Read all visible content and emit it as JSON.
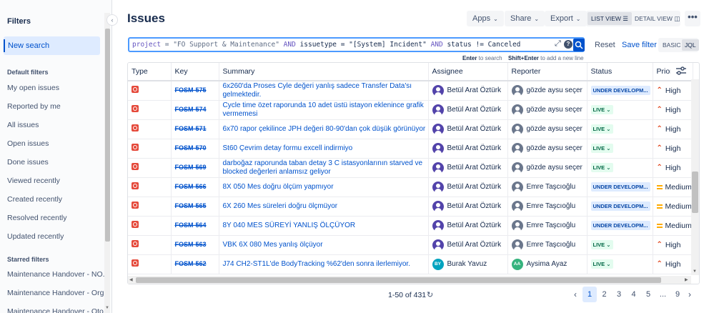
{
  "sidebar": {
    "title": "Filters",
    "new_search": "New search",
    "default_header": "Default filters",
    "default_items": [
      "My open issues",
      "Reported by me",
      "All issues",
      "Open issues",
      "Done issues",
      "Viewed recently",
      "Created recently",
      "Resolved recently",
      "Updated recently"
    ],
    "starred_header": "Starred filters",
    "starred_items": [
      "Maintenance Handover - NO...",
      "Maintenance Handover - Org...",
      "Maintenance Handover - Oto..."
    ]
  },
  "header": {
    "title": "Issues",
    "apps": "Apps",
    "share": "Share",
    "export": "Export",
    "list_view": "LIST VIEW",
    "detail_view": "DETAIL VIEW",
    "more": "•••"
  },
  "query": {
    "p1": "project",
    "p2": " = \"FO Support & Maintenance\" ",
    "and1": "AND",
    "p3": " issuetype = \"[System] Incident\" ",
    "and2": "AND",
    "p4": " status != Canceled",
    "hint_enter_key": "Enter",
    "hint_enter_text": " to search",
    "hint_shift_key": "Shift+Enter",
    "hint_shift_text": " to add a new line",
    "reset": "Reset",
    "save_filter": "Save filter",
    "basic": "BASIC",
    "jql": "JQL"
  },
  "table": {
    "columns": [
      "Type",
      "Key",
      "Summary",
      "Assignee",
      "Reporter",
      "Status",
      "Priori"
    ],
    "rows": [
      {
        "key": "FOSM-575",
        "summary": "6x260'da Proses Cyle değeri yanlış sadece Transfer Data'sı gelmektedir.",
        "assignee": "Betül Arat Öztürk",
        "assignee_avatar": "photo-purple",
        "reporter": "gözde aysu seçer",
        "reporter_avatar": "photo-gray",
        "status": "UNDER DEVELOPM...",
        "status_type": "dev",
        "priority": "High"
      },
      {
        "key": "FOSM-574",
        "summary": "Cycle time özet raporunda 10 adet üstü istayon eklenince grafik vermemesi",
        "assignee": "Betül Arat Öztürk",
        "assignee_avatar": "photo-purple",
        "reporter": "gözde aysu seçer",
        "reporter_avatar": "photo-gray",
        "status": "LIVE",
        "status_type": "live",
        "priority": "High"
      },
      {
        "key": "FOSM-571",
        "summary": "6x70 rapor çekilince JPH değeri 80-90'dan çok düşük görünüyor",
        "assignee": "Betül Arat Öztürk",
        "assignee_avatar": "photo-purple",
        "reporter": "gözde aysu seçer",
        "reporter_avatar": "photo-gray",
        "status": "LIVE",
        "status_type": "live",
        "priority": "High"
      },
      {
        "key": "FOSM-570",
        "summary": "St60 Çevrim detay formu excell indirmiyo",
        "assignee": "Betül Arat Öztürk",
        "assignee_avatar": "photo-purple",
        "reporter": "gözde aysu seçer",
        "reporter_avatar": "photo-gray",
        "status": "LIVE",
        "status_type": "live",
        "priority": "High"
      },
      {
        "key": "FOSM-569",
        "summary": "darboğaz raporunda taban detay 3 C istasyonlarının starved ve blocked değerleri anlamsız geliyor",
        "assignee": "Betül Arat Öztürk",
        "assignee_avatar": "photo-purple",
        "reporter": "gözde aysu seçer",
        "reporter_avatar": "photo-gray",
        "status": "LIVE",
        "status_type": "live",
        "priority": "High"
      },
      {
        "key": "FOSM-566",
        "summary": "8X 050 Mes doğru ölçüm yapmıyor",
        "assignee": "Betül Arat Öztürk",
        "assignee_avatar": "photo-purple",
        "reporter": "Emre Taşcıoğlu",
        "reporter_avatar": "photo-gray",
        "status": "UNDER DEVELOPM...",
        "status_type": "dev",
        "priority": "Medium"
      },
      {
        "key": "FOSM-565",
        "summary": "6X 260 Mes süreleri doğru ölçmüyor",
        "assignee": "Betül Arat Öztürk",
        "assignee_avatar": "photo-purple",
        "reporter": "Emre Taşcıoğlu",
        "reporter_avatar": "photo-gray",
        "status": "UNDER DEVELOPM...",
        "status_type": "dev",
        "priority": "Medium"
      },
      {
        "key": "FOSM-564",
        "summary": "8Y 040 MES SÜREYİ YANLIŞ ÖLÇÜYOR",
        "assignee": "Betül Arat Öztürk",
        "assignee_avatar": "photo-purple",
        "reporter": "Emre Taşcıoğlu",
        "reporter_avatar": "photo-gray",
        "status": "UNDER DEVELOPM...",
        "status_type": "dev",
        "priority": "Medium"
      },
      {
        "key": "FOSM-563",
        "summary": "VBK 6X 080 Mes yanlış ölçüyor",
        "assignee": "Betül Arat Öztürk",
        "assignee_avatar": "photo-purple",
        "reporter": "Emre Taşcıoğlu",
        "reporter_avatar": "photo-gray",
        "status": "LIVE",
        "status_type": "live",
        "priority": "High"
      },
      {
        "key": "FOSM-562",
        "summary": "J74 CH2-ST1L'de BodyTracking %62'den sonra ilerlemiyor.",
        "assignee": "Burak Yavuz",
        "assignee_avatar": "initials-teal",
        "assignee_initials": "BY",
        "reporter": "Aysima Ayaz",
        "reporter_avatar": "initials-green",
        "reporter_initials": "AA",
        "status": "LIVE",
        "status_type": "live",
        "priority": "High"
      }
    ]
  },
  "pagination": {
    "count": "1-50 of 431",
    "pages": [
      "1",
      "2",
      "3",
      "4",
      "5",
      "...",
      "9"
    ],
    "current": "1"
  },
  "colors": {
    "brand": "#0052cc",
    "incident_red": "#e5493a",
    "priority_high": "#de350b",
    "priority_medium": "#ffab00"
  }
}
